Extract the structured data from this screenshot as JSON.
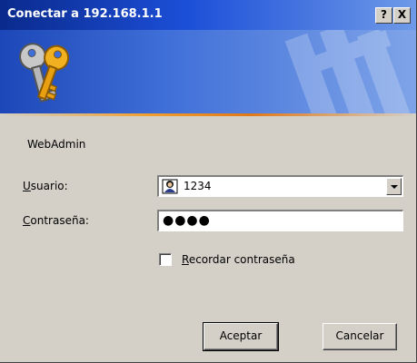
{
  "window": {
    "title": "Conectar a 192.168.1.1",
    "help_label": "?",
    "close_label": "X"
  },
  "dialog": {
    "realm": "WebAdmin",
    "user": {
      "label_key": "U",
      "label_rest": "suario:",
      "value": "1234"
    },
    "password": {
      "label_key": "C",
      "label_rest": "ontraseña:",
      "value": "●●●●"
    },
    "remember": {
      "label_key": "R",
      "label_rest": "ecordar contraseña",
      "checked": false
    },
    "buttons": {
      "ok_label": "Aceptar",
      "cancel_label": "Cancelar"
    }
  },
  "icons": {
    "banner": "keys-icon",
    "user": "user-icon",
    "combo_arrow": "chevron-down-icon"
  },
  "colors": {
    "titlebar": "#0a2a8c",
    "banner": "#3f6fd8",
    "accent_rule": "#f0a030",
    "dialog_bg": "#d4d0c8"
  }
}
